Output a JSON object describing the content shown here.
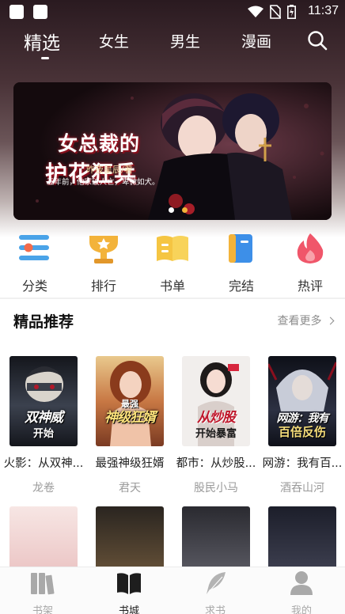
{
  "status_bar": {
    "time": "11:37"
  },
  "nav": {
    "tabs": [
      {
        "label": "精选",
        "active": true
      },
      {
        "label": "女生",
        "active": false
      },
      {
        "label": "男生",
        "active": false
      },
      {
        "label": "漫画",
        "active": false
      }
    ],
    "search_icon": "search-icon"
  },
  "banner": {
    "title_line1": "女总裁的",
    "title_line2": "护花狂兵",
    "author": "昨夜星辰/著",
    "tagline": "五年前，他家破人亡，卑微如犬。",
    "slide_count": 2,
    "active_slide": 2
  },
  "categories": [
    {
      "label": "分类",
      "icon": "list-icon",
      "color": "#4aa3e8"
    },
    {
      "label": "排行",
      "icon": "trophy-icon",
      "color": "#f3b33a"
    },
    {
      "label": "书单",
      "icon": "book-list-icon",
      "color": "#f5c542"
    },
    {
      "label": "完结",
      "icon": "bookmark-icon",
      "color": "#3d8fe8"
    },
    {
      "label": "热评",
      "icon": "flame-icon",
      "color": "#f0566a"
    }
  ],
  "section": {
    "title": "精品推荐",
    "more": "查看更多"
  },
  "books": [
    {
      "title": "火影：从双神...",
      "author": "龙卷",
      "cover_text": "双神威",
      "cover_sub": "开始",
      "cover_color": "#2b2f3a"
    },
    {
      "title": "最强神级狂婿",
      "author": "君天",
      "cover_text": "神级狂婿",
      "cover_sub": "最强",
      "cover_color": "#b45a2e"
    },
    {
      "title": "都市：从炒股...",
      "author": "股民小马",
      "cover_text": "从炒股",
      "cover_sub": "开始暴富",
      "cover_color": "#eae4e2"
    },
    {
      "title": "网游：我有百...",
      "author": "酒吞山河",
      "cover_text": "网游：我有",
      "cover_sub": "百倍反伤",
      "cover_color": "#1c1f2b"
    }
  ],
  "books_row2": [
    {
      "cover_color": "#f2d6d6"
    },
    {
      "cover_color": "#5a4a3a"
    },
    {
      "cover_color": "#3a3a40"
    },
    {
      "cover_color": "#2a2c38"
    }
  ],
  "bottom_nav": [
    {
      "label": "书架",
      "icon": "bookshelf-icon",
      "active": false
    },
    {
      "label": "书城",
      "icon": "open-book-icon",
      "active": true
    },
    {
      "label": "求书",
      "icon": "feather-icon",
      "active": false
    },
    {
      "label": "我的",
      "icon": "user-icon",
      "active": false
    }
  ]
}
